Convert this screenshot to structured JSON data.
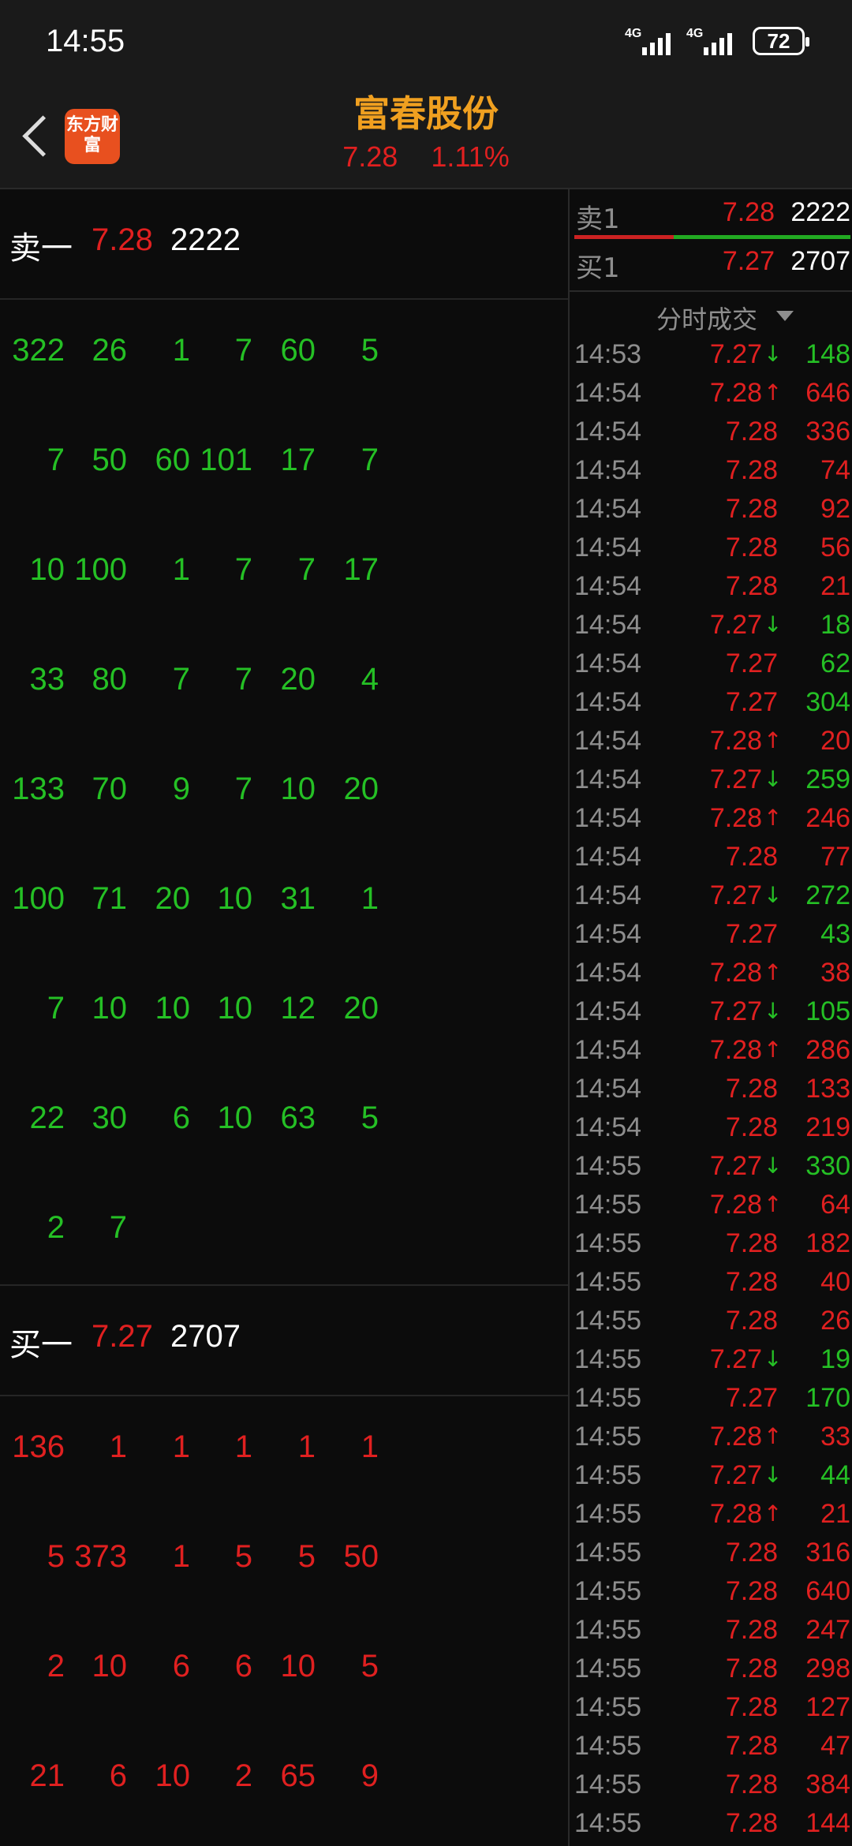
{
  "status_bar": {
    "time": "14:55",
    "signal_labels": [
      "4G",
      "4G"
    ],
    "battery": "72"
  },
  "header": {
    "title": "富春股份",
    "price": "7.28",
    "change_pct": "1.11%",
    "logo_text": "东方财富"
  },
  "colors": {
    "up": "#e02020",
    "down": "#25c025",
    "title": "#f0a020"
  },
  "sell_queue": {
    "label": "卖一",
    "price": "7.28",
    "volume": "2222",
    "color": "green",
    "rows": [
      [
        "322",
        "26",
        "1",
        "7",
        "60",
        "5"
      ],
      [
        "7",
        "50",
        "60",
        "101",
        "17",
        "7"
      ],
      [
        "10",
        "100",
        "1",
        "7",
        "7",
        "17"
      ],
      [
        "33",
        "80",
        "7",
        "7",
        "20",
        "4"
      ],
      [
        "133",
        "70",
        "9",
        "7",
        "10",
        "20"
      ],
      [
        "100",
        "71",
        "20",
        "10",
        "31",
        "1"
      ],
      [
        "7",
        "10",
        "10",
        "10",
        "12",
        "20"
      ],
      [
        "22",
        "30",
        "6",
        "10",
        "63",
        "5"
      ],
      [
        "2",
        "7"
      ]
    ]
  },
  "buy_queue": {
    "label": "买一",
    "price": "7.27",
    "volume": "2707",
    "color": "red",
    "rows": [
      [
        "136",
        "1",
        "1",
        "1",
        "1",
        "1"
      ],
      [
        "5",
        "373",
        "1",
        "5",
        "5",
        "50"
      ],
      [
        "2",
        "10",
        "6",
        "6",
        "10",
        "5"
      ],
      [
        "21",
        "6",
        "10",
        "2",
        "65",
        "9"
      ]
    ]
  },
  "quote_panel": {
    "sell1": {
      "label": "卖1",
      "price": "7.28",
      "volume": "2222"
    },
    "buy1": {
      "label": "买1",
      "price": "7.27",
      "volume": "2707"
    },
    "ticks_header": "分时成交"
  },
  "ticks": [
    {
      "time": "14:53",
      "price": "7.27",
      "arrow": "↓",
      "vol": "148",
      "pc": "red",
      "vc": "green"
    },
    {
      "time": "14:54",
      "price": "7.28",
      "arrow": "↑",
      "vol": "646",
      "pc": "red",
      "vc": "red"
    },
    {
      "time": "14:54",
      "price": "7.28",
      "arrow": "",
      "vol": "336",
      "pc": "red",
      "vc": "red"
    },
    {
      "time": "14:54",
      "price": "7.28",
      "arrow": "",
      "vol": "74",
      "pc": "red",
      "vc": "red"
    },
    {
      "time": "14:54",
      "price": "7.28",
      "arrow": "",
      "vol": "92",
      "pc": "red",
      "vc": "red"
    },
    {
      "time": "14:54",
      "price": "7.28",
      "arrow": "",
      "vol": "56",
      "pc": "red",
      "vc": "red"
    },
    {
      "time": "14:54",
      "price": "7.28",
      "arrow": "",
      "vol": "21",
      "pc": "red",
      "vc": "red"
    },
    {
      "time": "14:54",
      "price": "7.27",
      "arrow": "↓",
      "vol": "18",
      "pc": "red",
      "vc": "green"
    },
    {
      "time": "14:54",
      "price": "7.27",
      "arrow": "",
      "vol": "62",
      "pc": "red",
      "vc": "green"
    },
    {
      "time": "14:54",
      "price": "7.27",
      "arrow": "",
      "vol": "304",
      "pc": "red",
      "vc": "green"
    },
    {
      "time": "14:54",
      "price": "7.28",
      "arrow": "↑",
      "vol": "20",
      "pc": "red",
      "vc": "red"
    },
    {
      "time": "14:54",
      "price": "7.27",
      "arrow": "↓",
      "vol": "259",
      "pc": "red",
      "vc": "green"
    },
    {
      "time": "14:54",
      "price": "7.28",
      "arrow": "↑",
      "vol": "246",
      "pc": "red",
      "vc": "red"
    },
    {
      "time": "14:54",
      "price": "7.28",
      "arrow": "",
      "vol": "77",
      "pc": "red",
      "vc": "red"
    },
    {
      "time": "14:54",
      "price": "7.27",
      "arrow": "↓",
      "vol": "272",
      "pc": "red",
      "vc": "green"
    },
    {
      "time": "14:54",
      "price": "7.27",
      "arrow": "",
      "vol": "43",
      "pc": "red",
      "vc": "green"
    },
    {
      "time": "14:54",
      "price": "7.28",
      "arrow": "↑",
      "vol": "38",
      "pc": "red",
      "vc": "red"
    },
    {
      "time": "14:54",
      "price": "7.27",
      "arrow": "↓",
      "vol": "105",
      "pc": "red",
      "vc": "green"
    },
    {
      "time": "14:54",
      "price": "7.28",
      "arrow": "↑",
      "vol": "286",
      "pc": "red",
      "vc": "red"
    },
    {
      "time": "14:54",
      "price": "7.28",
      "arrow": "",
      "vol": "133",
      "pc": "red",
      "vc": "red"
    },
    {
      "time": "14:54",
      "price": "7.28",
      "arrow": "",
      "vol": "219",
      "pc": "red",
      "vc": "red"
    },
    {
      "time": "14:55",
      "price": "7.27",
      "arrow": "↓",
      "vol": "330",
      "pc": "red",
      "vc": "green"
    },
    {
      "time": "14:55",
      "price": "7.28",
      "arrow": "↑",
      "vol": "64",
      "pc": "red",
      "vc": "red"
    },
    {
      "time": "14:55",
      "price": "7.28",
      "arrow": "",
      "vol": "182",
      "pc": "red",
      "vc": "red"
    },
    {
      "time": "14:55",
      "price": "7.28",
      "arrow": "",
      "vol": "40",
      "pc": "red",
      "vc": "red"
    },
    {
      "time": "14:55",
      "price": "7.28",
      "arrow": "",
      "vol": "26",
      "pc": "red",
      "vc": "red"
    },
    {
      "time": "14:55",
      "price": "7.27",
      "arrow": "↓",
      "vol": "19",
      "pc": "red",
      "vc": "green"
    },
    {
      "time": "14:55",
      "price": "7.27",
      "arrow": "",
      "vol": "170",
      "pc": "red",
      "vc": "green"
    },
    {
      "time": "14:55",
      "price": "7.28",
      "arrow": "↑",
      "vol": "33",
      "pc": "red",
      "vc": "red"
    },
    {
      "time": "14:55",
      "price": "7.27",
      "arrow": "↓",
      "vol": "44",
      "pc": "red",
      "vc": "green"
    },
    {
      "time": "14:55",
      "price": "7.28",
      "arrow": "↑",
      "vol": "21",
      "pc": "red",
      "vc": "red"
    },
    {
      "time": "14:55",
      "price": "7.28",
      "arrow": "",
      "vol": "316",
      "pc": "red",
      "vc": "red"
    },
    {
      "time": "14:55",
      "price": "7.28",
      "arrow": "",
      "vol": "640",
      "pc": "red",
      "vc": "red"
    },
    {
      "time": "14:55",
      "price": "7.28",
      "arrow": "",
      "vol": "247",
      "pc": "red",
      "vc": "red"
    },
    {
      "time": "14:55",
      "price": "7.28",
      "arrow": "",
      "vol": "298",
      "pc": "red",
      "vc": "red"
    },
    {
      "time": "14:55",
      "price": "7.28",
      "arrow": "",
      "vol": "127",
      "pc": "red",
      "vc": "red"
    },
    {
      "time": "14:55",
      "price": "7.28",
      "arrow": "",
      "vol": "47",
      "pc": "red",
      "vc": "red"
    },
    {
      "time": "14:55",
      "price": "7.28",
      "arrow": "",
      "vol": "384",
      "pc": "red",
      "vc": "red"
    },
    {
      "time": "14:55",
      "price": "7.28",
      "arrow": "",
      "vol": "144",
      "pc": "red",
      "vc": "red"
    }
  ]
}
